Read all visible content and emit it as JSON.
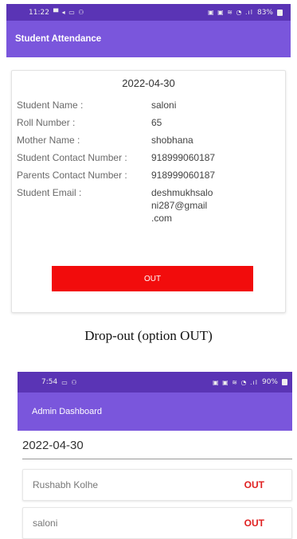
{
  "screen1": {
    "status_bar": {
      "time": "11:22",
      "icons": "▀ ◂ ▭ ⚇",
      "right_icons": "▣ ▣ ≋ ◔ .ıl",
      "battery": "83%"
    },
    "app_title": "Student Attendance",
    "date": "2022-04-30",
    "details": [
      {
        "label": "Student Name :",
        "value": "saloni"
      },
      {
        "label": "Roll Number :",
        "value": "65"
      },
      {
        "label": "Mother Name :",
        "value": "shobhana"
      },
      {
        "label": "Student Contact Number :",
        "value": "918999060187"
      },
      {
        "label": "Parents Contact Number :",
        "value": "918999060187"
      },
      {
        "label": "Student Email :",
        "value_lines": [
          "deshmukhsalo",
          "ni287@gmail",
          ".com"
        ]
      }
    ],
    "out_button_label": "OUT",
    "colors": {
      "status_bar": "#5a34b5",
      "app_bar": "#7a56dc",
      "out_button": "#f20c0c"
    }
  },
  "caption": "Drop-out (option OUT)",
  "screen2": {
    "status_bar": {
      "time": "7:54",
      "icons": "▭ ⚇",
      "right_icons": "▣ ▣ ≋ ◔ .ıl",
      "battery": "90%"
    },
    "app_title": "Admin Dashboard",
    "date": "2022-04-30",
    "students": [
      {
        "name": "Rushabh Kolhe",
        "status": "OUT"
      },
      {
        "name": "saloni",
        "status": "OUT"
      }
    ],
    "colors": {
      "status_text": "#e02020"
    }
  }
}
